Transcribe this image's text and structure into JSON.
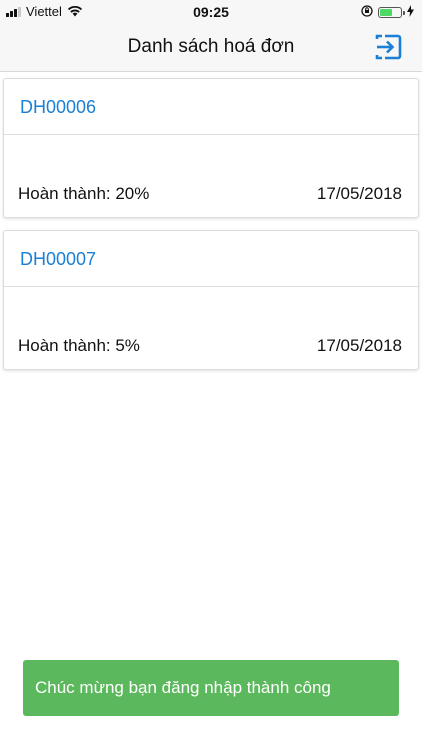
{
  "status_bar": {
    "carrier": "Viettel",
    "time": "09:25",
    "battery_level": 0.6
  },
  "header": {
    "title": "Danh sách hoá đơn",
    "logout_icon": "logout-icon"
  },
  "invoices": [
    {
      "code": "DH00006",
      "progress_label": "Hoàn thành: 20%",
      "date": "17/05/2018"
    },
    {
      "code": "DH00007",
      "progress_label": "Hoàn thành: 5%",
      "date": "17/05/2018"
    }
  ],
  "toast": {
    "message": "Chúc mừng bạn đăng nhập thành công"
  },
  "colors": {
    "accent": "#1a7fd6",
    "toast_bg": "#5cb85c",
    "battery": "#4cd964"
  }
}
